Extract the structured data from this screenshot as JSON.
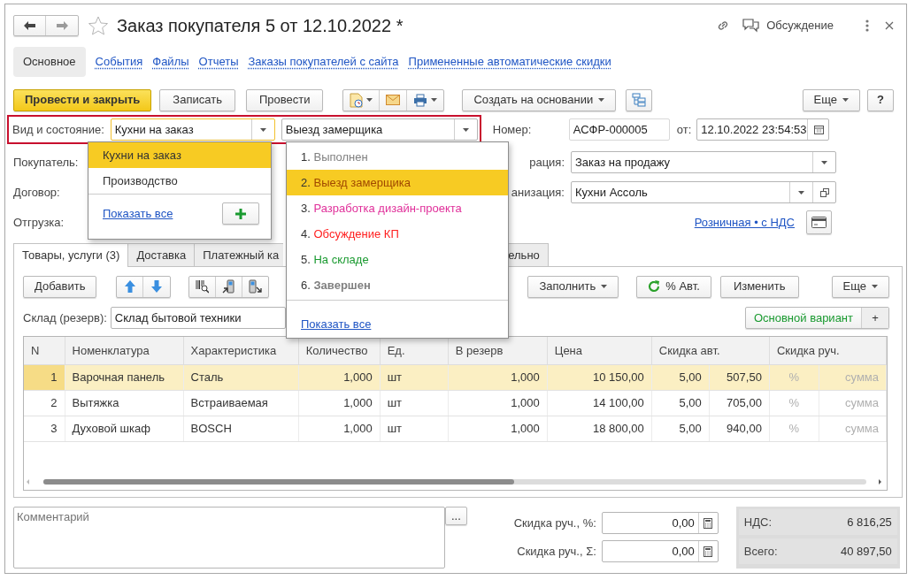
{
  "window": {
    "title": "Заказ покупателя 5 от 12.10.2022 *",
    "discussion": "Обсуждение"
  },
  "nav": [
    {
      "label": "Основное",
      "selected": true
    },
    {
      "label": "События",
      "selected": false
    },
    {
      "label": "Файлы",
      "selected": false
    },
    {
      "label": "Отчеты",
      "selected": false
    },
    {
      "label": "Заказы покупателей с сайта",
      "selected": false
    },
    {
      "label": "Примененные автоматические скидки",
      "selected": false
    }
  ],
  "toolbar": {
    "post_close": "Провести и закрыть",
    "save": "Записать",
    "post": "Провести",
    "create_based": "Создать на основании",
    "more": "Еще",
    "help": "?"
  },
  "header_fields": {
    "kind_label": "Вид и состояние:",
    "kind_value": "Кухни на заказ",
    "state_value": "Выезд замерщика",
    "number_label": "Номер:",
    "number_value": "АСФР-000005",
    "date_label": "от:",
    "date_value": "12.10.2022 23:54:53",
    "customer_label": "Покупатель:",
    "operation_label": "рация:",
    "operation_value": "Заказ на продажу",
    "contract_label": "Договор:",
    "organization_label": "анизация:",
    "organization_value": "Кухни Ассоль",
    "shipment_label": "Отгрузка:",
    "price_link": "Розничная • с НДС"
  },
  "kind_dropdown": {
    "items": [
      {
        "label": "Кухни на заказ",
        "selected": true
      },
      {
        "label": "Производство",
        "selected": false
      }
    ],
    "show_all": "Показать все"
  },
  "state_dropdown": {
    "items": [
      {
        "number": "1.",
        "label": "Выполнен",
        "color": "#808080",
        "bold": false,
        "selected": false
      },
      {
        "number": "2.",
        "label": "Выезд замерщика",
        "color": "#a04800",
        "bold": false,
        "selected": true
      },
      {
        "number": "3.",
        "label": "Разработка дизайн-проекта",
        "color": "#e0309a",
        "bold": false,
        "selected": false
      },
      {
        "number": "4.",
        "label": "Обсуждение КП",
        "color": "#ff2020",
        "bold": false,
        "selected": false
      },
      {
        "number": "5.",
        "label": "На складе",
        "color": "#1a9a30",
        "bold": false,
        "selected": false
      },
      {
        "number": "6.",
        "label": "Завершен",
        "color": "#808080",
        "bold": true,
        "selected": false
      }
    ],
    "show_all": "Показать все"
  },
  "tabs": [
    {
      "label": "Товары, услуги (3)",
      "selected": true
    },
    {
      "label": "Доставка",
      "selected": false
    },
    {
      "label": "Платежный ка",
      "selected": false
    },
    {
      "label": "ельно",
      "selected": false
    }
  ],
  "goods_toolbar": {
    "add": "Добавить",
    "fill": "Заполнить",
    "auto_discount": "% Авт.",
    "change": "Изменить",
    "more": "Еще"
  },
  "warehouse": {
    "label": "Склад (резерв):",
    "value": "Склад бытовой техники"
  },
  "variant": {
    "label": "Основной вариант",
    "add": "+"
  },
  "table": {
    "columns": [
      "N",
      "Номенклатура",
      "Характеристика",
      "Количество",
      "Ед.",
      "В резерв",
      "Цена",
      "Скидка авт.",
      "Скидка руч."
    ],
    "rows": [
      {
        "selected": true,
        "cells": [
          "1",
          "Варочная панель",
          "Сталь",
          "1,000",
          "шт",
          "1,000",
          "10 150,00",
          [
            "5,00",
            "507,50"
          ],
          [
            "%",
            "сумма"
          ]
        ]
      },
      {
        "selected": false,
        "cells": [
          "2",
          "Вытяжка",
          "Встраиваемая",
          "1,000",
          "шт",
          "1,000",
          "14 100,00",
          [
            "5,00",
            "705,00"
          ],
          [
            "%",
            "сумма"
          ]
        ]
      },
      {
        "selected": false,
        "cells": [
          "3",
          "Духовой шкаф",
          "BOSCH",
          "1,000",
          "шт",
          "1,000",
          "18 800,00",
          [
            "5,00",
            "940,00"
          ],
          [
            "%",
            "сумма"
          ]
        ]
      }
    ]
  },
  "footer": {
    "comment_placeholder": "Комментарий",
    "comment_button": "...",
    "manual_pct_label": "Скидка руч., %:",
    "manual_pct_value": "0,00",
    "manual_sum_label": "Скидка руч., Σ:",
    "manual_sum_value": "0,00",
    "vat_label": "НДС:",
    "vat_value": "6 816,25",
    "total_label": "Всего:",
    "total_value": "40 897,50"
  }
}
